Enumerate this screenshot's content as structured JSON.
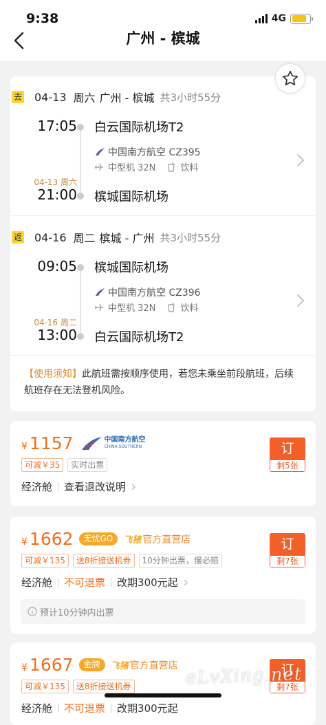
{
  "status": {
    "time": "9:38",
    "network": "4G"
  },
  "nav": {
    "title": "广州 - 槟城"
  },
  "outbound": {
    "tag": "去",
    "date": "04-13",
    "weekday": "周六",
    "route": "广州 - 槟城",
    "duration": "共3小时55分",
    "dep_time": "17:05",
    "dep_airport": "白云国际机场T2",
    "airline": "中国南方航空 CZ395",
    "aircraft": "中型机 32N",
    "meal": "饮料",
    "arr_date": "04-13 周六",
    "arr_time": "21:00",
    "arr_airport": "槟城国际机场"
  },
  "inbound": {
    "tag": "返",
    "date": "04-16",
    "weekday": "周二",
    "route": "槟城 - 广州",
    "duration": "共3小时55分",
    "dep_time": "09:05",
    "dep_airport": "槟城国际机场",
    "airline": "中国南方航空 CZ396",
    "aircraft": "中型机 32N",
    "meal": "饮料",
    "arr_date": "04-16 周二",
    "arr_time": "13:00",
    "arr_airport": "白云国际机场T2"
  },
  "notice": {
    "highlight": "【使用须知】",
    "text": "此航班需按顺序使用，若您未乘坐前段航班，后续航班存在无法登机风险。"
  },
  "offers": [
    {
      "currency": "¥",
      "price": "1157",
      "logo_cn": "中国南方航空",
      "logo_en": "CHINA SOUTHERN",
      "chips": [
        "可减￥35",
        "实时出票"
      ],
      "cabin": "经济舱",
      "link": "查看退改说明",
      "book": "订",
      "remain": "剩5张"
    },
    {
      "currency": "¥",
      "price": "1662",
      "badge": "无忧GO",
      "brand": "飞猪",
      "shop": "官方直营店",
      "chips": [
        "可减￥135",
        "送8折接送机券",
        "10分钟出票，慢必赔"
      ],
      "cabin": "经济舱",
      "refund": "不可退票",
      "change": "改期300元起",
      "note": "预计10分钟内出票",
      "book": "订",
      "remain": "剩7张"
    },
    {
      "currency": "¥",
      "price": "1667",
      "badge": "金牌",
      "brand": "飞猪",
      "shop": "官方直营店",
      "chips": [
        "可减￥135",
        "送8折接送机券"
      ],
      "cabin": "经济舱",
      "refund": "不可退票",
      "change": "改期300元起",
      "book": "订",
      "remain": "剩7张"
    }
  ],
  "watermark": "eLvXing.net",
  "colors": {
    "accent": "#f26f1f",
    "tag": "#fcd531",
    "bg": "#f2f2f2"
  }
}
